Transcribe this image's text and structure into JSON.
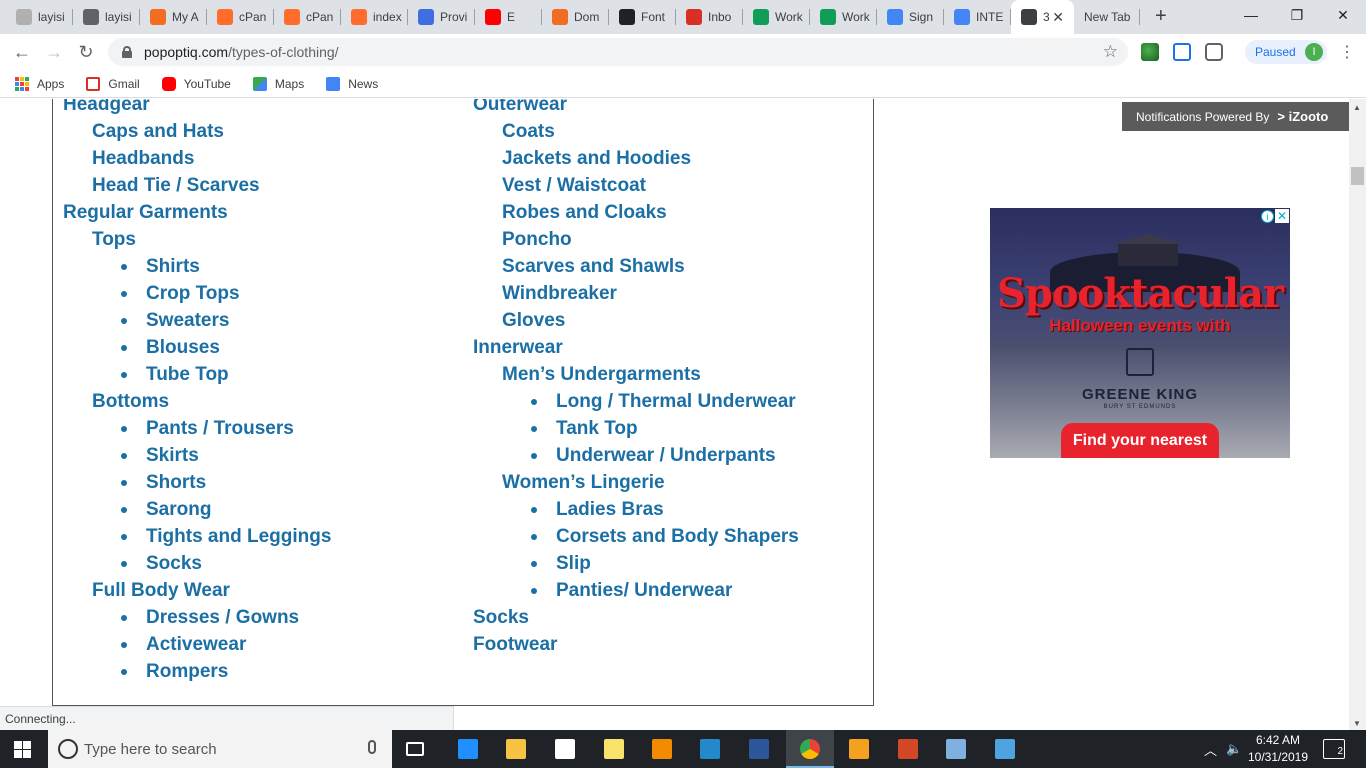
{
  "browser": {
    "tabs": [
      {
        "label": "layisi",
        "favicon_color": "#b0b0b0",
        "favicon": "flag-icon"
      },
      {
        "label": "layisi",
        "favicon_color": "#5f6368",
        "favicon": "globe-icon"
      },
      {
        "label": "My A",
        "favicon_color": "#f26c22",
        "favicon": "n-icon"
      },
      {
        "label": "cPan",
        "favicon_color": "#ff6c2c",
        "favicon": "cpanel-icon"
      },
      {
        "label": "cPan",
        "favicon_color": "#ff6c2c",
        "favicon": "cpanel-icon"
      },
      {
        "label": "index",
        "favicon_color": "#ff6c2c",
        "favicon": "cpanel-icon"
      },
      {
        "label": "Provi",
        "favicon_color": "#3f6ee0",
        "favicon": "chat-icon"
      },
      {
        "label": "E",
        "favicon_color": "#ff0000",
        "favicon": "youtube-icon"
      },
      {
        "label": "Dom",
        "favicon_color": "#f26c22",
        "favicon": "n-icon"
      },
      {
        "label": "Font",
        "favicon_color": "#202124",
        "favicon": "font-icon"
      },
      {
        "label": "Inbo",
        "favicon_color": "#d93025",
        "favicon": "gmail-icon"
      },
      {
        "label": "Work",
        "favicon_color": "#0f9d58",
        "favicon": "sheets-icon"
      },
      {
        "label": "Work",
        "favicon_color": "#0f9d58",
        "favicon": "sheets-icon"
      },
      {
        "label": "Sign",
        "favicon_color": "#4285f4",
        "favicon": "google-icon"
      },
      {
        "label": "INTE",
        "favicon_color": "#4285f4",
        "favicon": "docs-icon"
      },
      {
        "label": "3",
        "favicon_color": "#3c4043",
        "favicon": "site-icon",
        "active": true
      },
      {
        "label": "New Tab",
        "favicon_color": "",
        "favicon": ""
      }
    ],
    "url_host": "popoptiq.com",
    "url_path": "/types-of-clothing/",
    "profile_status": "Paused",
    "profile_initial": "I",
    "bookmarks": [
      {
        "label": "Apps",
        "icon": "apps-icon"
      },
      {
        "label": "Gmail",
        "icon": "gmail-icon",
        "color": "#d93025"
      },
      {
        "label": "YouTube",
        "icon": "youtube-icon",
        "color": "#ff0000"
      },
      {
        "label": "Maps",
        "icon": "maps-icon",
        "color": "#34a853"
      },
      {
        "label": "News",
        "icon": "news-icon",
        "color": "#4285f4"
      }
    ],
    "status_text": "Connecting..."
  },
  "content": {
    "link_color": "#1c6fa5",
    "left_column": [
      {
        "text": "Headgear",
        "level": 0
      },
      {
        "text": "Caps and Hats",
        "level": 1
      },
      {
        "text": "Headbands",
        "level": 1
      },
      {
        "text": "Head Tie / Scarves",
        "level": 1
      },
      {
        "text": "Regular Garments",
        "level": 0
      },
      {
        "text": "Tops",
        "level": 1
      },
      {
        "text": "Shirts",
        "level": 2
      },
      {
        "text": "Crop Tops",
        "level": 2
      },
      {
        "text": "Sweaters",
        "level": 2
      },
      {
        "text": "Blouses",
        "level": 2
      },
      {
        "text": "Tube Top",
        "level": 2
      },
      {
        "text": "Bottoms",
        "level": 1
      },
      {
        "text": "Pants / Trousers",
        "level": 2
      },
      {
        "text": "Skirts",
        "level": 2
      },
      {
        "text": "Shorts",
        "level": 2
      },
      {
        "text": "Sarong",
        "level": 2
      },
      {
        "text": "Tights and Leggings",
        "level": 2
      },
      {
        "text": "Socks",
        "level": 2
      },
      {
        "text": "Full Body Wear",
        "level": 1
      },
      {
        "text": "Dresses / Gowns",
        "level": 2
      },
      {
        "text": "Activewear",
        "level": 2
      },
      {
        "text": "Rompers",
        "level": 2
      }
    ],
    "right_column": [
      {
        "text": "Outerwear",
        "level": 0
      },
      {
        "text": "Coats",
        "level": 1
      },
      {
        "text": "Jackets and Hoodies",
        "level": 1
      },
      {
        "text": "Vest / Waistcoat",
        "level": 1
      },
      {
        "text": "Robes and Cloaks",
        "level": 1
      },
      {
        "text": "Poncho",
        "level": 1
      },
      {
        "text": "Scarves and Shawls",
        "level": 1
      },
      {
        "text": "Windbreaker",
        "level": 1
      },
      {
        "text": "Gloves",
        "level": 1
      },
      {
        "text": "Innerwear",
        "level": 0
      },
      {
        "text": "Men’s Undergarments",
        "level": 1
      },
      {
        "text": "Long / Thermal Underwear",
        "level": 2
      },
      {
        "text": "Tank Top",
        "level": 2
      },
      {
        "text": "Underwear / Underpants",
        "level": 2
      },
      {
        "text": "Women’s Lingerie",
        "level": 1
      },
      {
        "text": "Ladies Bras",
        "level": 2
      },
      {
        "text": "Corsets and Body Shapers",
        "level": 2
      },
      {
        "text": "Slip",
        "level": 2
      },
      {
        "text": "Panties/ Underwear",
        "level": 2
      },
      {
        "text": "Socks",
        "level": 0
      },
      {
        "text": "Footwear",
        "level": 0
      }
    ]
  },
  "notification_bar": {
    "text": "Notifications Powered By",
    "brand": "iZooto"
  },
  "ad": {
    "headline": "Spooktacular",
    "subline": "Halloween events with",
    "brand": "GREENE KING",
    "brand_sub": "BURY ST EDMUNDS",
    "cta": "Find your nearest",
    "info": "i",
    "close": "✕"
  },
  "taskbar": {
    "search_placeholder": "Type here to search",
    "time": "6:42 AM",
    "date": "10/31/2019",
    "notification_count": "2",
    "pinned_apps": [
      {
        "name": "task-view-icon",
        "color": "#ffffff"
      },
      {
        "name": "edge-icon",
        "color": "#1e90ff"
      },
      {
        "name": "file-explorer-icon",
        "color": "#f6c342"
      },
      {
        "name": "store-icon",
        "color": "#ffffff"
      },
      {
        "name": "sticky-notes-icon",
        "color": "#f8e36b"
      },
      {
        "name": "sublime-icon",
        "color": "#f28b00"
      },
      {
        "name": "vscode-icon",
        "color": "#2489ca"
      },
      {
        "name": "word-icon",
        "color": "#2b579a"
      },
      {
        "name": "chrome-icon",
        "color": "#4caf50"
      },
      {
        "name": "box-app-icon",
        "color": "#f4a020"
      },
      {
        "name": "powerpoint-icon",
        "color": "#d24726"
      },
      {
        "name": "paint-icon",
        "color": "#7fb0e0"
      },
      {
        "name": "remote-desktop-icon",
        "color": "#4fa3e0"
      }
    ]
  }
}
